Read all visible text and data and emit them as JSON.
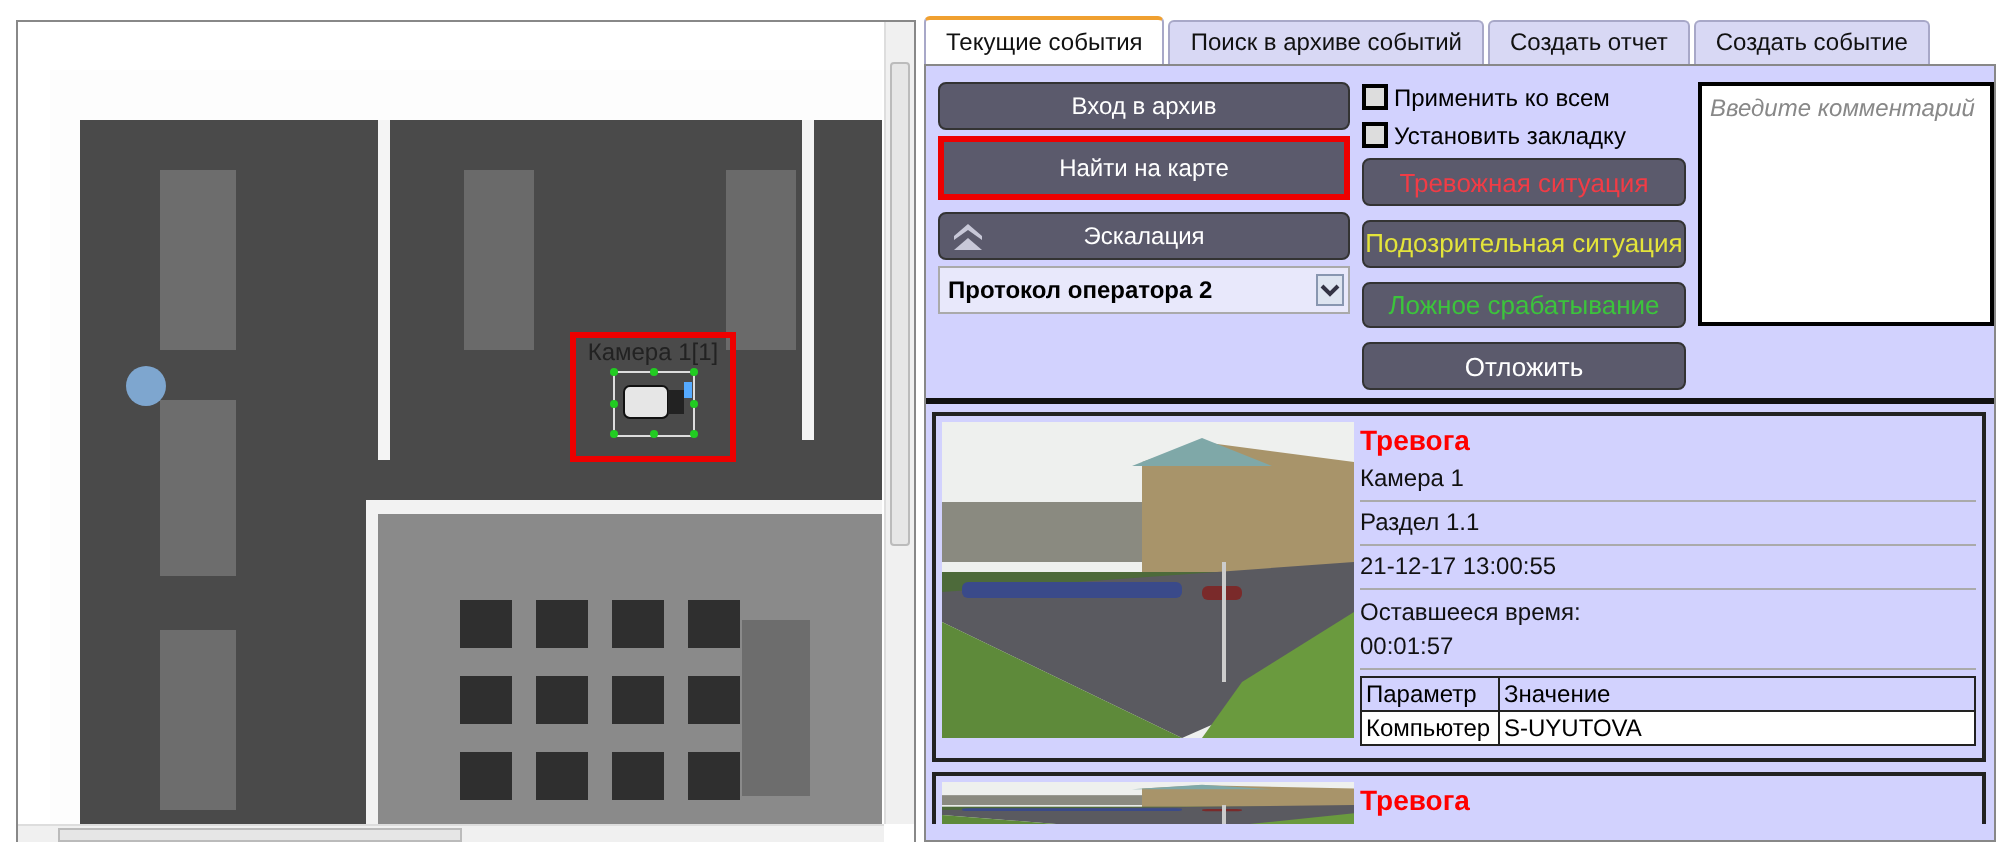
{
  "map": {
    "camera": {
      "label": "Камера 1[1]",
      "highlighted": true
    }
  },
  "tabs": [
    {
      "label": "Текущие события",
      "selected": true
    },
    {
      "label": "Поиск в архиве событий",
      "selected": false
    },
    {
      "label": "Создать отчет",
      "selected": false
    },
    {
      "label": "Создать событие",
      "selected": false
    }
  ],
  "actions": {
    "buttons": [
      {
        "label": "Вход в архив",
        "highlighted": false
      },
      {
        "label": "Найти на карте",
        "highlighted": true
      }
    ],
    "escalation": {
      "label": "Эскалация"
    },
    "protocol": {
      "value": "Протокол оператора 2"
    },
    "checkboxes": [
      {
        "label": "Применить ко всем",
        "checked": false
      },
      {
        "label": "Установить закладку",
        "checked": false
      }
    ],
    "verdicts": [
      {
        "label": "Тревожная ситуация",
        "color": "#f03c46"
      },
      {
        "label": "Подозрительная ситуация",
        "color": "#e4e43a"
      },
      {
        "label": "Ложное срабатывание",
        "color": "#3cc43c"
      }
    ],
    "postpone": {
      "label": "Отложить"
    },
    "comment": {
      "placeholder": "Введите комментарий"
    }
  },
  "events": [
    {
      "title": "Тревога",
      "lines": [
        "Камера 1",
        "Раздел 1.1",
        "21-12-17 13:00:55"
      ],
      "remaining": {
        "label": "Оставшееся время:",
        "value": "00:01:57"
      },
      "params": {
        "columns": [
          "Параметр",
          "Значение"
        ],
        "rows": [
          [
            "Компьютер",
            "S-UYUTOVA"
          ]
        ]
      }
    },
    {
      "title": "Тревога"
    }
  ]
}
